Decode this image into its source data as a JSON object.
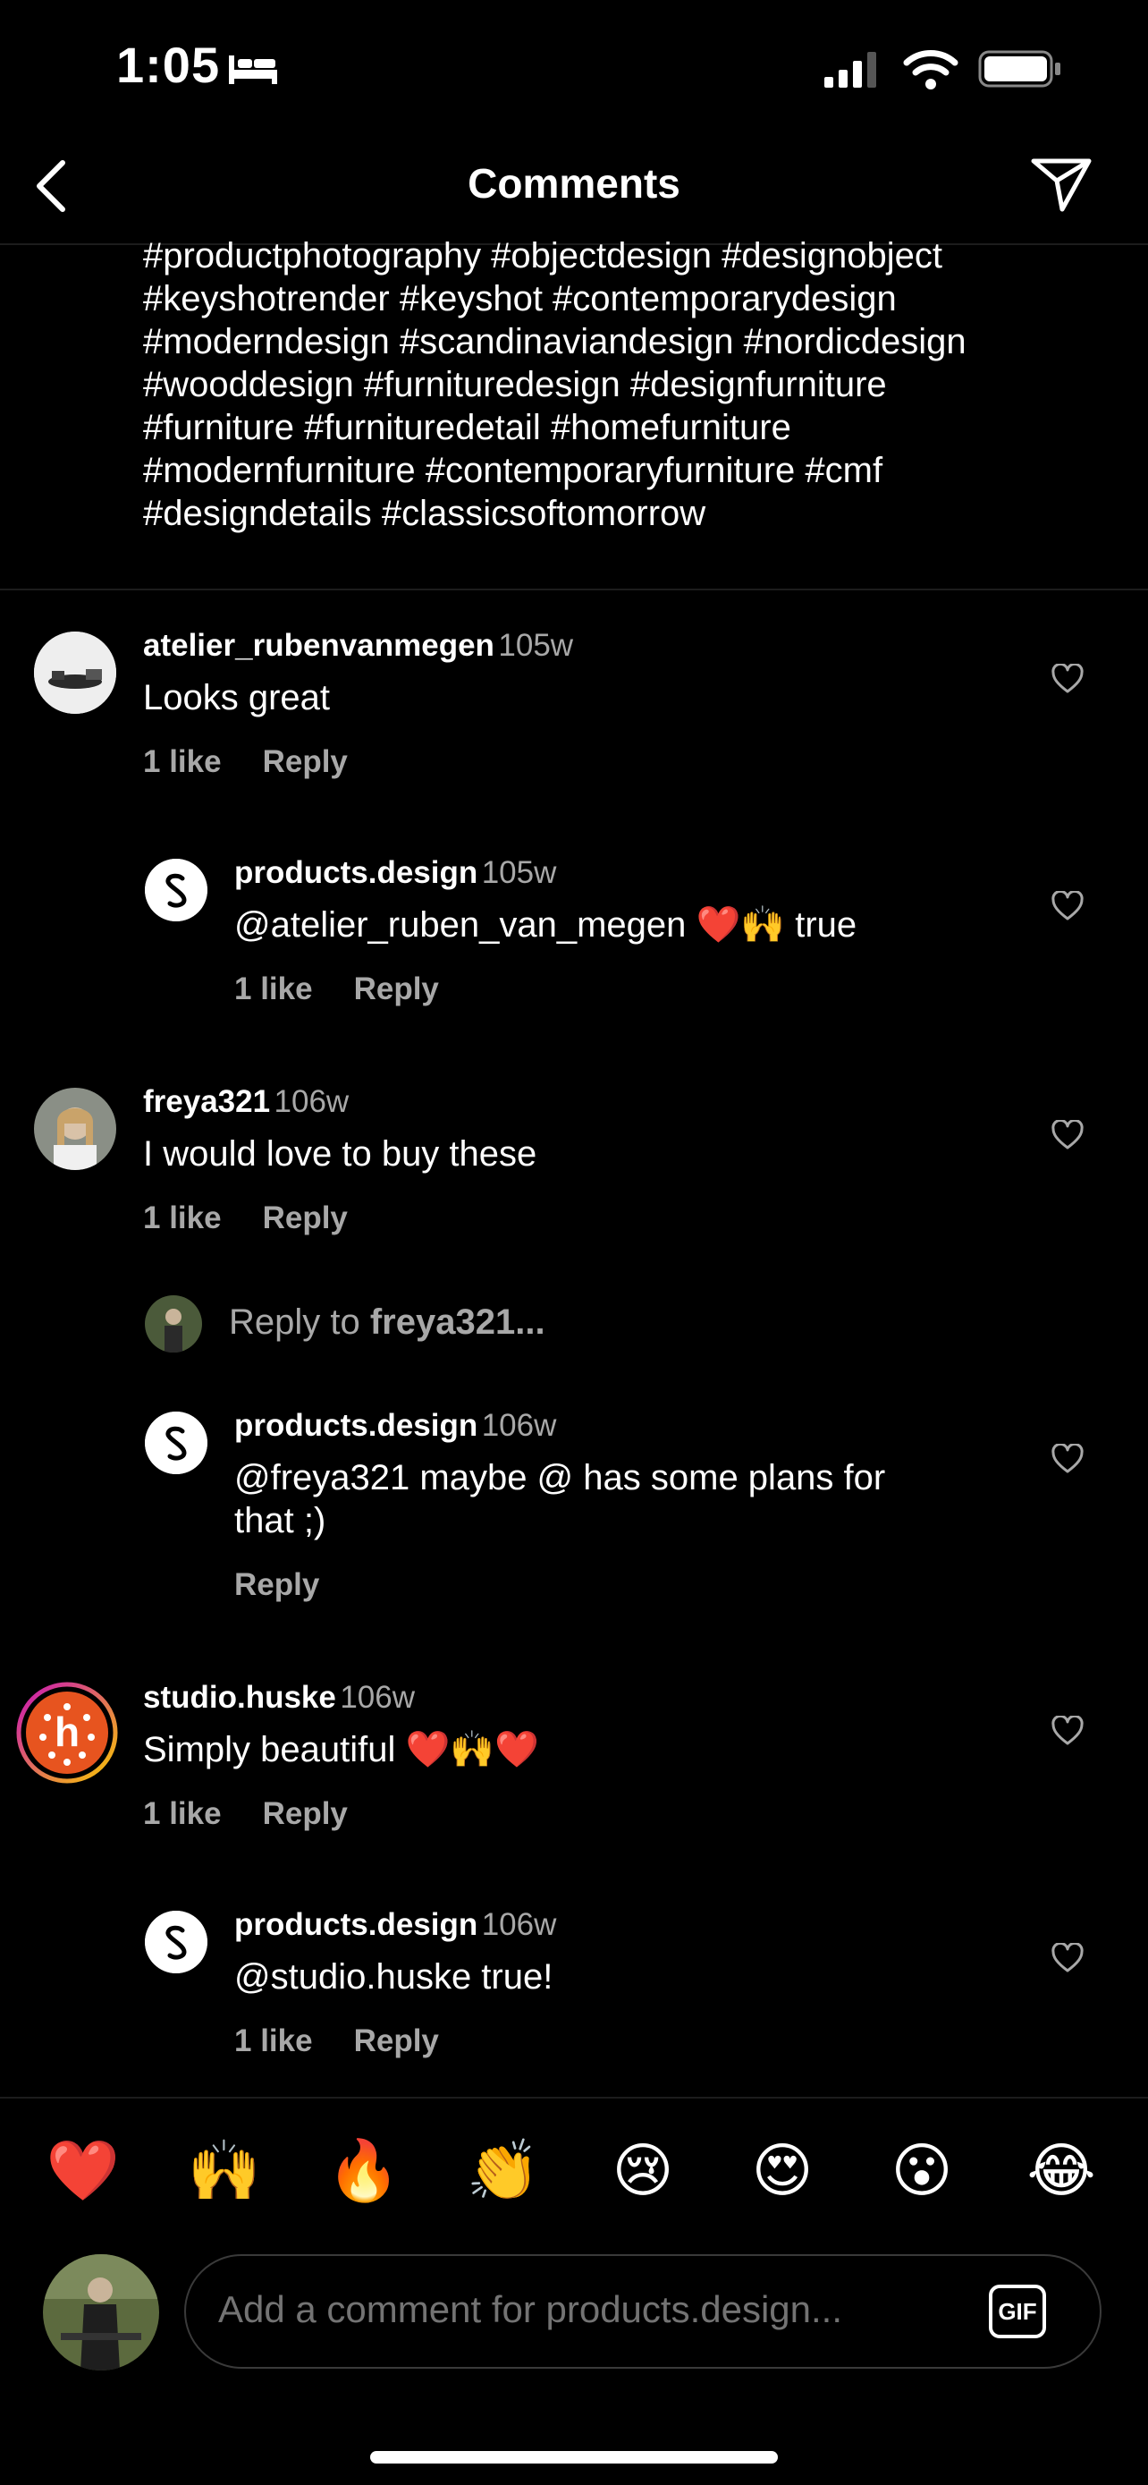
{
  "status_bar": {
    "time": "1:05",
    "sleep_icon": "bed-icon",
    "signal_icon": "cellular-signal-icon",
    "wifi_icon": "wifi-icon",
    "battery_icon": "battery-icon"
  },
  "header": {
    "title": "Comments",
    "back_icon": "chevron-left-icon",
    "share_icon": "paper-plane-icon"
  },
  "caption": {
    "text": "#productphotography #objectdesign #designobject\n#keyshotrender #keyshot #contemporarydesign\n#moderndesign #scandinaviandesign #nordicdesign\n#wooddesign #furnituredesign #designfurniture\n#furniture #furnituredetail #homefurniture\n#modernfurniture #contemporaryfurniture #cmf\n#designdetails #classicsoftomorrow"
  },
  "comments": [
    {
      "username": "atelier_rubenvanmegen",
      "time": "105w",
      "text": "Looks great",
      "likes": "1 like",
      "reply": "Reply"
    },
    {
      "username": "products.design",
      "time": "105w",
      "text": "@atelier_ruben_van_megen ❤️🙌 true",
      "likes": "1 like",
      "reply": "Reply"
    },
    {
      "username": "freya321",
      "time": "106w",
      "text": "I would love to buy these",
      "likes": "1 like",
      "reply": "Reply"
    },
    {
      "username": "products.design",
      "time": "106w",
      "text": "@freya321 maybe @ has some plans for\nthat ;)",
      "reply": "Reply"
    },
    {
      "username": "studio.huske",
      "time": "106w",
      "text": "Simply beautiful ❤️🙌❤️",
      "likes": "1 like",
      "reply": "Reply"
    },
    {
      "username": "products.design",
      "time": "106w",
      "text": "@studio.huske true!",
      "likes": "1 like",
      "reply": "Reply"
    }
  ],
  "reply_hint": {
    "prefix": "Reply to ",
    "user": "freya321..."
  },
  "emoji_bar": [
    "❤️",
    "🙌",
    "🔥",
    "👏",
    "😢",
    "😍",
    "😮",
    "😂"
  ],
  "composer": {
    "placeholder": "Add a comment for products.design...",
    "gif_label": "GIF"
  },
  "colors": {
    "background": "#000000",
    "secondary_text": "#a8a8a8",
    "story_ring_start": "#c913b9",
    "story_ring_end": "#f9c800"
  }
}
